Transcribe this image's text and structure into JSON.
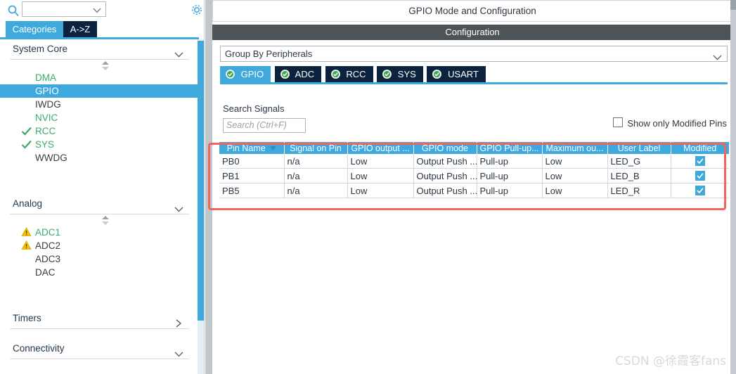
{
  "left_panel": {
    "search": {
      "value": "",
      "placeholder": ""
    },
    "icons": {
      "search": "search-icon",
      "gear": "gear-icon",
      "chevron": "chevron-down-icon"
    },
    "tabs": [
      {
        "label": "Categories",
        "active": true
      },
      {
        "label": "A->Z",
        "active": false
      }
    ],
    "groups": [
      {
        "title": "System Core",
        "expanded": true,
        "items": [
          {
            "label": "DMA",
            "state": "green",
            "mark": "none"
          },
          {
            "label": "GPIO",
            "state": "selected",
            "mark": "none"
          },
          {
            "label": "IWDG",
            "state": "grey",
            "mark": "none"
          },
          {
            "label": "NVIC",
            "state": "green",
            "mark": "none"
          },
          {
            "label": "RCC",
            "state": "green",
            "mark": "check"
          },
          {
            "label": "SYS",
            "state": "green",
            "mark": "check"
          },
          {
            "label": "WWDG",
            "state": "grey",
            "mark": "none"
          }
        ]
      },
      {
        "title": "Analog",
        "expanded": true,
        "items": [
          {
            "label": "ADC1",
            "state": "green",
            "mark": "warning"
          },
          {
            "label": "ADC2",
            "state": "grey",
            "mark": "warning"
          },
          {
            "label": "ADC3",
            "state": "grey",
            "mark": "none"
          },
          {
            "label": "DAC",
            "state": "grey",
            "mark": "none"
          }
        ]
      },
      {
        "title": "Timers",
        "expanded": false,
        "items": []
      },
      {
        "title": "Connectivity",
        "expanded": true,
        "items": []
      }
    ]
  },
  "right_panel": {
    "title": "GPIO Mode and Configuration",
    "configuration_bar": "Configuration",
    "group_by": {
      "value": "Group By Peripherals"
    },
    "peripheral_tabs": [
      {
        "label": "GPIO",
        "active": true
      },
      {
        "label": "ADC",
        "active": false
      },
      {
        "label": "RCC",
        "active": false
      },
      {
        "label": "SYS",
        "active": false
      },
      {
        "label": "USART",
        "active": false
      }
    ],
    "search_signals_label": "Search Signals",
    "signal_search": {
      "value": "",
      "placeholder": "Search (Ctrl+F)"
    },
    "show_only_modified": {
      "label": "Show only Modified Pins",
      "checked": false
    },
    "table": {
      "columns": [
        "Pin Name",
        "Signal on Pin",
        "GPIO output ...",
        "GPIO mode",
        "GPIO Pull-up...",
        "Maximum ou...",
        "User Label",
        "Modified"
      ],
      "sorted_column_index": 0,
      "rows": [
        {
          "pin_name": "PB0",
          "signal_on_pin": "n/a",
          "gpio_output": "Low",
          "gpio_mode": "Output Push ...",
          "gpio_pullup": "Pull-up",
          "maximum_output": "Low",
          "user_label": "LED_G",
          "modified": true
        },
        {
          "pin_name": "PB1",
          "signal_on_pin": "n/a",
          "gpio_output": "Low",
          "gpio_mode": "Output Push ...",
          "gpio_pullup": "Pull-up",
          "maximum_output": "Low",
          "user_label": "LED_B",
          "modified": true
        },
        {
          "pin_name": "PB5",
          "signal_on_pin": "n/a",
          "gpio_output": "Low",
          "gpio_mode": "Output Push ...",
          "gpio_pullup": "Pull-up",
          "maximum_output": "Low",
          "user_label": "LED_R",
          "modified": true
        }
      ]
    }
  },
  "annotation": {
    "highlight_color": "#f2635c"
  },
  "watermark": "CSDN @徐霞客fans",
  "colors": {
    "accent_blue": "#3fa9dd",
    "dark_navy": "#0c2340",
    "green": "#3aaa6b",
    "config_bar": "#4e5357",
    "warning_yellow": "#f2c200"
  }
}
